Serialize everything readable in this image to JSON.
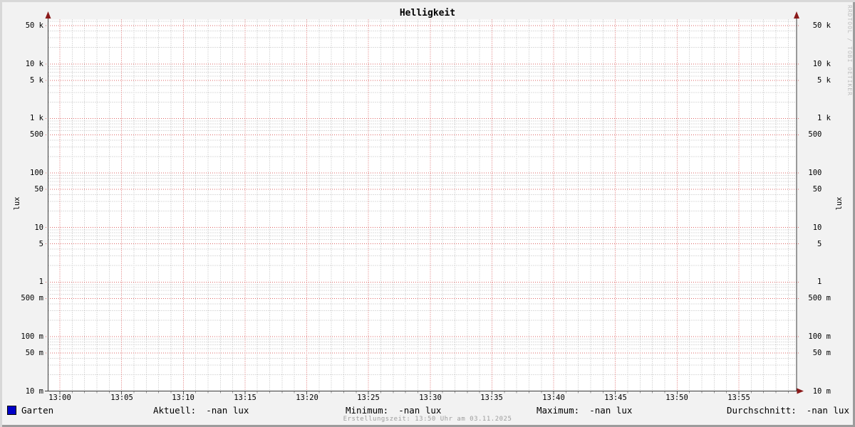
{
  "title": "Helligkeit",
  "watermark": "RRDTOOL / TOBI OETIKER",
  "footer": "Erstellungszeit: 13:50 Uhr am 03.11.2025",
  "colors": {
    "background": "#f2f2f2",
    "canvas": "#ffffff",
    "major_grid": "#dd6666",
    "minor_grid": "#bbbbbb",
    "axis": "#3a3a3a",
    "arrow": "#8b1a1a",
    "series_garten": "#0000c8",
    "footer_text": "#9e9e9e",
    "watermark_text": "#bdbdbd",
    "border_light": "#d8d8d8",
    "border_dark": "#9c9c9c"
  },
  "chart_data": {
    "type": "line",
    "title": "Helligkeit",
    "ylabel": "lux",
    "ylabel_right": "lux",
    "y_scale": "log",
    "ylim": [
      0.01,
      65000
    ],
    "grid": true,
    "y_ticks": [
      {
        "label": "50 k",
        "value": 50000
      },
      {
        "label": "10 k",
        "value": 10000
      },
      {
        "label": "5 k",
        "value": 5000
      },
      {
        "label": "1 k",
        "value": 1000
      },
      {
        "label": "500",
        "value": 500
      },
      {
        "label": "100",
        "value": 100
      },
      {
        "label": "50",
        "value": 50
      },
      {
        "label": "10",
        "value": 10
      },
      {
        "label": "5",
        "value": 5
      },
      {
        "label": "1",
        "value": 1
      },
      {
        "label": "500 m",
        "value": 0.5
      },
      {
        "label": "100 m",
        "value": 0.1
      },
      {
        "label": "50 m",
        "value": 0.05
      },
      {
        "label": "10 m",
        "value": 0.01
      }
    ],
    "x_ticks": [
      {
        "label": "13:00",
        "minute": 0
      },
      {
        "label": "13:05",
        "minute": 5
      },
      {
        "label": "13:10",
        "minute": 10
      },
      {
        "label": "13:15",
        "minute": 15
      },
      {
        "label": "13:20",
        "minute": 20
      },
      {
        "label": "13:25",
        "minute": 25
      },
      {
        "label": "13:30",
        "minute": 30
      },
      {
        "label": "13:35",
        "minute": 35
      },
      {
        "label": "13:40",
        "minute": 40
      },
      {
        "label": "13:45",
        "minute": 45
      },
      {
        "label": "13:50",
        "minute": 50
      },
      {
        "label": "13:55",
        "minute": 55
      }
    ],
    "x_minor_step_minutes": 1,
    "series": [
      {
        "name": "Garten",
        "color": "#0000c8",
        "values": []
      }
    ]
  },
  "legend": {
    "series_label": "Garten",
    "items": [
      {
        "label": "Aktuell:",
        "value": "-nan lux"
      },
      {
        "label": "Minimum:",
        "value": "-nan lux"
      },
      {
        "label": "Maximum:",
        "value": "-nan lux"
      },
      {
        "label": "Durchschnitt:",
        "value": "-nan lux"
      }
    ]
  }
}
